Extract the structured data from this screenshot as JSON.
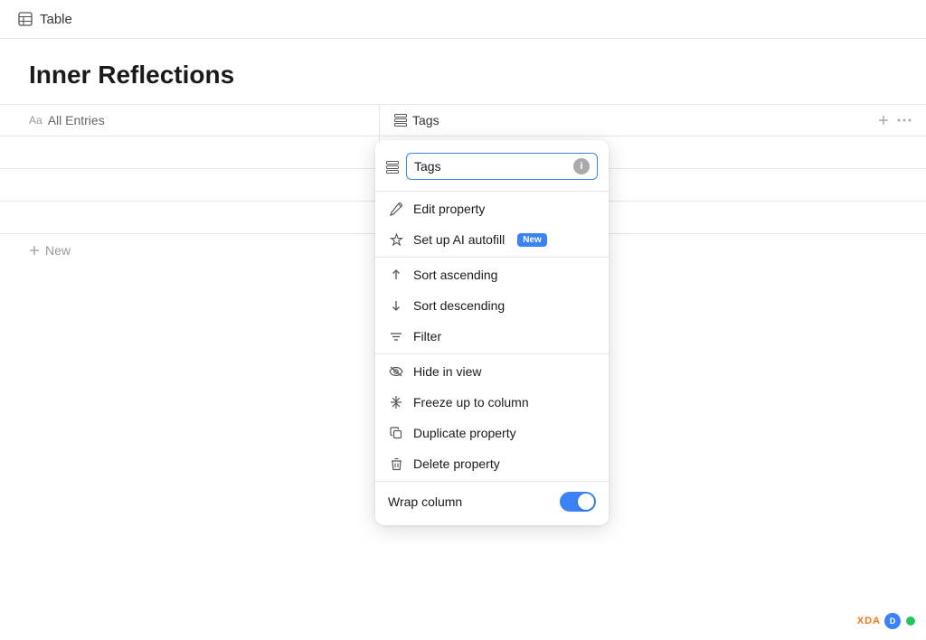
{
  "topbar": {
    "icon": "table-icon",
    "title": "Table"
  },
  "page": {
    "title": "Inner Reflections"
  },
  "columns": {
    "entries": {
      "prefix": "Aa",
      "label": "All Entries"
    },
    "tags": {
      "label": "Tags"
    }
  },
  "new_row": {
    "label": "New"
  },
  "dropdown": {
    "input": {
      "value": "Tags",
      "placeholder": "Tags"
    },
    "items": [
      {
        "id": "edit-property",
        "label": "Edit property",
        "icon": "edit-icon",
        "badge": null
      },
      {
        "id": "set-up-ai-autofill",
        "label": "Set up AI autofill",
        "icon": "ai-icon",
        "badge": "New"
      },
      {
        "id": "sort-ascending",
        "label": "Sort ascending",
        "icon": "sort-asc-icon",
        "badge": null
      },
      {
        "id": "sort-descending",
        "label": "Sort descending",
        "icon": "sort-desc-icon",
        "badge": null
      },
      {
        "id": "filter",
        "label": "Filter",
        "icon": "filter-icon",
        "badge": null
      },
      {
        "id": "hide-in-view",
        "label": "Hide in view",
        "icon": "hide-icon",
        "badge": null
      },
      {
        "id": "freeze-up-to-column",
        "label": "Freeze up to column",
        "icon": "freeze-icon",
        "badge": null
      },
      {
        "id": "duplicate-property",
        "label": "Duplicate property",
        "icon": "duplicate-icon",
        "badge": null
      },
      {
        "id": "delete-property",
        "label": "Delete property",
        "icon": "delete-icon",
        "badge": null
      }
    ],
    "wrap_column": {
      "label": "Wrap column",
      "enabled": true
    }
  },
  "accent_color": "#3b82f6"
}
